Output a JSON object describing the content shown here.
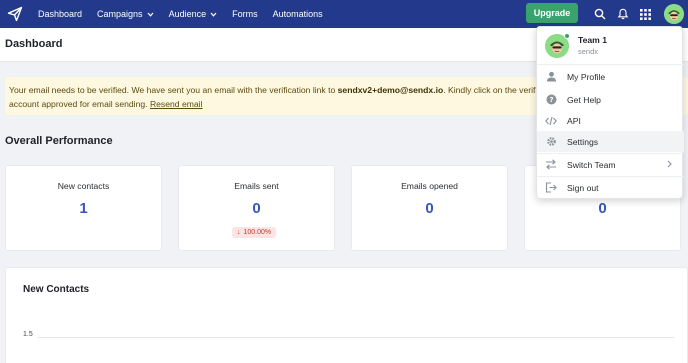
{
  "nav": {
    "items": [
      {
        "label": "Dashboard"
      },
      {
        "label": "Campaigns",
        "dropdown": true
      },
      {
        "label": "Audience",
        "dropdown": true
      },
      {
        "label": "Forms"
      },
      {
        "label": "Automations"
      }
    ],
    "upgrade_label": "Upgrade",
    "icons": [
      "search-icon",
      "bell-icon",
      "apps-grid-icon",
      "avatar"
    ]
  },
  "page": {
    "title": "Dashboard"
  },
  "alert": {
    "text_before": "Your email needs to be verified. We have sent you an email with the verification link to ",
    "email": "sendxv2+demo@sendx.io",
    "text_mid": ". Kindly click on the verifica",
    "text_line2": "account approved for email sending. ",
    "resend_label": "Resend email"
  },
  "performance": {
    "title": "Overall Performance",
    "cards": [
      {
        "label": "New contacts",
        "value": "1"
      },
      {
        "label": "Emails sent",
        "value": "0",
        "badge": "100.00%"
      },
      {
        "label": "Emails opened",
        "value": "0"
      },
      {
        "label": "",
        "value": "0"
      }
    ]
  },
  "new_contacts": {
    "title": "New Contacts",
    "y_tick": "1.5"
  },
  "dropdown": {
    "team_name": "Team 1",
    "team_sub": "sendx",
    "items": [
      {
        "label": "My Profile",
        "icon": "user-icon"
      },
      {
        "label": "Get Help",
        "icon": "help-icon"
      },
      {
        "label": "API",
        "icon": "code-icon"
      },
      {
        "label": "Settings",
        "icon": "gear-icon"
      },
      {
        "label": "Switch Team",
        "icon": "switch-icon"
      },
      {
        "label": "Sign out",
        "icon": "sign-out-icon"
      }
    ]
  },
  "colors": {
    "nav_bg": "#233a8c",
    "upgrade_bg": "#3aa36b",
    "value_blue": "#3857b8",
    "alert_bg": "#fff8e0",
    "badge_bg": "#fde4e4",
    "badge_text": "#c0392b"
  }
}
